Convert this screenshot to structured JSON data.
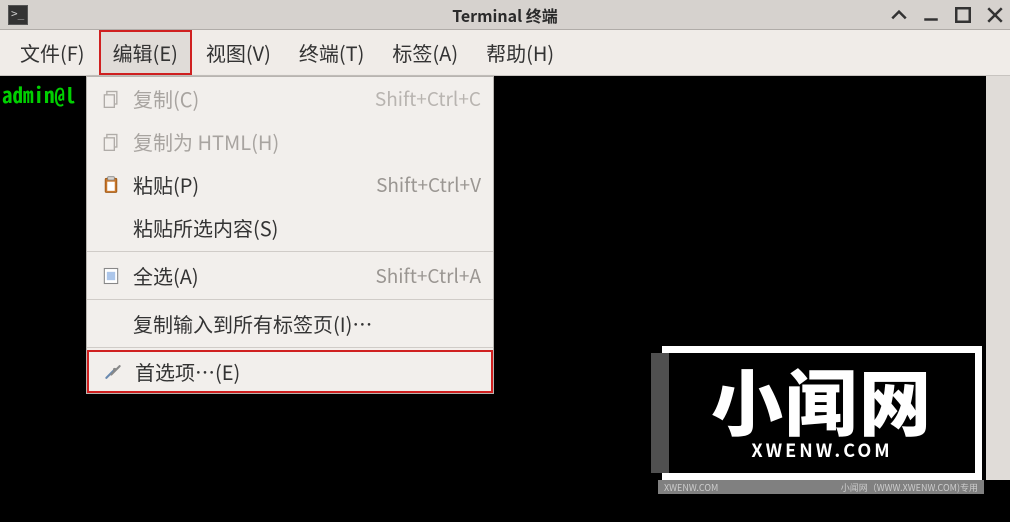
{
  "titlebar": {
    "title": "Terminal 终端"
  },
  "menubar": {
    "items": [
      {
        "label": "文件(F)"
      },
      {
        "label": "编辑(E)"
      },
      {
        "label": "视图(V)"
      },
      {
        "label": "终端(T)"
      },
      {
        "label": "标签(A)"
      },
      {
        "label": "帮助(H)"
      }
    ]
  },
  "terminal": {
    "prompt": "admin@l"
  },
  "dropdown": {
    "copy": {
      "label": "复制(C)",
      "shortcut": "Shift+Ctrl+C"
    },
    "copy_html": {
      "label": "复制为 HTML(H)",
      "shortcut": ""
    },
    "paste": {
      "label": "粘贴(P)",
      "shortcut": "Shift+Ctrl+V"
    },
    "paste_sel": {
      "label": "粘贴所选内容(S)",
      "shortcut": ""
    },
    "select_all": {
      "label": "全选(A)",
      "shortcut": "Shift+Ctrl+A"
    },
    "copy_to_tabs": {
      "label": "复制输入到所有标签页(I)…",
      "shortcut": ""
    },
    "prefs": {
      "label": "首选项…(E)",
      "shortcut": ""
    }
  },
  "watermark": {
    "main": "小闻网",
    "sub": "XWENW.COM"
  },
  "footer": {
    "left": "XWENW.COM",
    "right": "小闻网（WWW.XWENW.COM)专用"
  }
}
